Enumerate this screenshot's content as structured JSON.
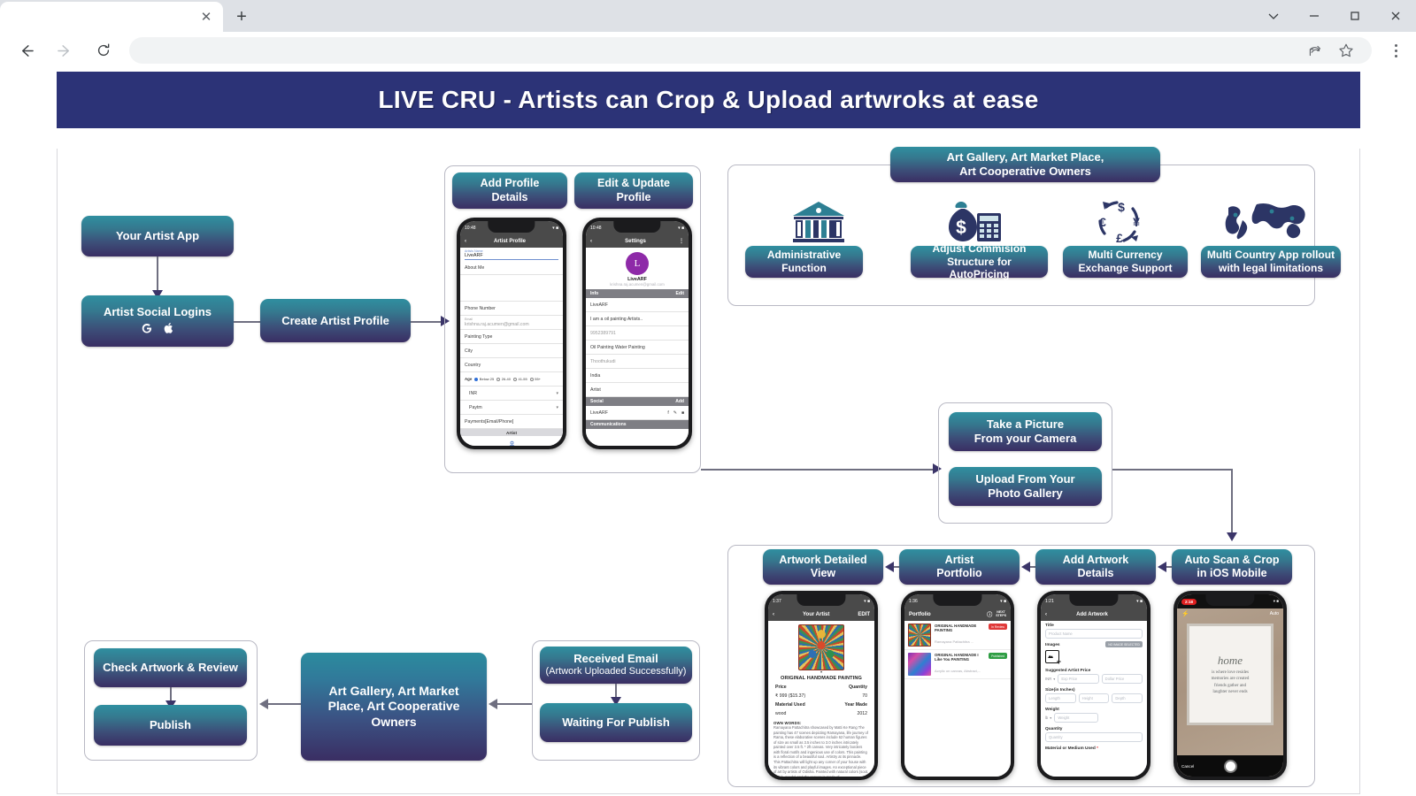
{
  "browser": {
    "tab_title": "",
    "tab_close_icon": "close-icon",
    "new_tab_icon": "plus-icon",
    "window_controls": [
      "chevron-down-icon",
      "minimize-icon",
      "maximize-icon",
      "close-icon"
    ],
    "back_icon": "back-arrow-icon",
    "forward_icon": "forward-arrow-icon",
    "reload_icon": "reload-icon",
    "address_value": "",
    "address_placeholder": "",
    "share_icon": "share-icon",
    "bookmark_icon": "star-icon",
    "menu_icon": "kebab-menu-icon"
  },
  "banner": {
    "title": "LIVE CRU - Artists can Crop & Upload artwroks at ease",
    "bg": "#2c3377"
  },
  "theme": {
    "gradient_top": "#2f8fa0",
    "gradient_bottom": "#3a2e63",
    "line": "#6f6f80",
    "border": "#b9b9c4"
  },
  "flow": {
    "your_artist_app": "Your Artist App",
    "artist_social_logins": "Artist Social Logins",
    "social_icons": [
      "google-icon",
      "apple-icon"
    ],
    "create_artist_profile": "Create Artist Profile",
    "add_profile_details": "Add Profile\nDetails",
    "add_profile_details_l1": "Add Profile",
    "add_profile_details_l2": "Details",
    "edit_update_profile_l1": "Edit & Update",
    "edit_update_profile_l2": "Profile",
    "take_picture_l1": "Take a Picture",
    "take_picture_l2": "From your Camera",
    "upload_gallery_l1": "Upload From Your",
    "upload_gallery_l2": "Photo Gallery",
    "auto_scan_l1": "Auto Scan & Crop",
    "auto_scan_l2": "in iOS Mobile",
    "add_artwork_details_l1": "Add Artwork",
    "add_artwork_details_l2": "Details",
    "artist_portfolio_l1": "Artist",
    "artist_portfolio_l2": "Portfolio",
    "artwork_detailed_view_l1": "Artwork Detailed",
    "artwork_detailed_view_l2": "View",
    "received_email_l1": "Received Email",
    "received_email_l2": "(Artwork Uploaded Successfully)",
    "waiting_for_publish": "Waiting For Publish",
    "gallery_owners_l1": "Art Gallery, Art Market",
    "gallery_owners_l2": "Place, Art Cooperative",
    "gallery_owners_l3": "Owners",
    "check_artwork_review": "Check Artwork & Review",
    "publish": "Publish"
  },
  "gallery_panel": {
    "header_l1": "Art Gallery, Art Market Place,",
    "header_l2": "Art Cooperative Owners",
    "features": [
      {
        "icon": "bank-building-icon",
        "label_l1": "Administrative",
        "label_l2": "Function"
      },
      {
        "icon": "money-bag-calculator-icon",
        "label_l1": "Adjust Commision",
        "label_l2": "Structure for AutoPricing"
      },
      {
        "icon": "currency-exchange-icon",
        "label_l1": "Multi Currency",
        "label_l2": "Exchange Support"
      },
      {
        "icon": "world-map-icon",
        "label_l1": "Multi Country App rollout",
        "label_l2": "with legal limitations"
      }
    ]
  },
  "phones": {
    "artist_profile": {
      "time": "10:48",
      "title": "Artist Profile",
      "back_icon": "chevron-left-icon",
      "field_label": "Artists Name",
      "field_value": "LiveARF",
      "rows": [
        "About Me",
        "",
        "Phone Number",
        "krishna.raj.acumen@gmail.com",
        "Painting Type",
        "City",
        "Country"
      ],
      "email_label": "Email",
      "age_label": "Age",
      "age_options": [
        "Below 25",
        "26-40",
        "41-55",
        "55+"
      ],
      "age_selected": "Below 25",
      "pay_rows": [
        "INR",
        "Paytm",
        "Payments[Email/Phone]"
      ],
      "tabbar": "Artist",
      "tabbar_icon": "person-icon"
    },
    "settings": {
      "time": "10:48",
      "title": "Settings",
      "back_icon": "chevron-left-icon",
      "more_icon": "more-vertical-icon",
      "avatar_letter": "L",
      "profile_name": "LiveARF",
      "profile_email": "krishna.raj.acumen@gmail.com",
      "info_header": "Info",
      "info_edit": "Edit",
      "info_rows": [
        "LiveARF",
        "I am a oil painting Artists..",
        "9952389791",
        "Oil Painting Water Painting",
        "Thoothukudi",
        "India",
        "Artist"
      ],
      "social_header": "Social",
      "social_add": "Add",
      "social_row": "LiveARF",
      "social_icons": [
        "facebook-icon",
        "edit-pencil-icon",
        "delete-icon"
      ],
      "footer_row": "Communications"
    },
    "artwork_detail": {
      "time": "1:37",
      "title": "Your Artist",
      "edit": "EDIT",
      "back_icon": "chevron-left-icon",
      "artwork_title": "ORIGINAL HANDMADE PAINTING",
      "price_label": "Price",
      "quantity_label": "Quantity",
      "price_value": "₹ 999 ($15.37)",
      "quantity_value": "70",
      "material_label": "Material Used",
      "year_label": "Year Made",
      "material_value": "wood",
      "year_value": "2012",
      "own_words_label": "OWN WORDS:",
      "own_words_text": "Ramayana Pattachitra showcased by Matti Ke Rang The painting has 47 scenes depicting Ramayana, life journey of Rama, these elaborative scenes include 62 human figures of size as small as 3.5 inches to 3.0 inches intricately painted over 3.5 ft. * 2ft canvas. Very intricately borders with floral motifs and ingenious use of colors. This painting is a reflection of a beautiful soul. Artistry at its pinnacle. This Pattachitra will light up any corner of your house with its vibrant colors and playful images. An exceptional piece of art by artists of Odisha. Painted with natural colors (soot, conch, seeds) and the canvas is made of"
    },
    "portfolio": {
      "time": "1:36",
      "title": "Portfolio",
      "info_icon": "info-icon",
      "next_steps": "NEXT\nSTEPS",
      "next_steps_l1": "NEXT",
      "next_steps_l2": "STEPS",
      "items": [
        {
          "name": "ORIGINAL HANDMADE PAINTING",
          "desc": "Ramayana Pattachitra ...",
          "badge": "In Review",
          "badge_color": "#e03a3a"
        },
        {
          "name": "ORIGINAL HANDMADE I Like You PAINTING",
          "desc": "Acrylic on canvas, Abstract,...",
          "badge": "Published",
          "badge_color": "#2f9e44"
        }
      ],
      "fab_icon": "plus-icon"
    },
    "add_artwork": {
      "time": "1:21",
      "title": "Add Artwork",
      "back_icon": "chevron-left-icon",
      "title_label": "Title",
      "title_placeholder": "Product Name",
      "images_label": "Images",
      "images_chip": "NO IMAGE SELECTED",
      "image_picker_icon": "add-image-icon",
      "price_label": "Suggested Artist Price",
      "price_currency": "INR",
      "price_placeholder_1": "Exp Price",
      "price_placeholder_2": "Dollar Price",
      "size_label": "Size(in Inches)",
      "size_placeholders": [
        "Length",
        "Height",
        "Depth"
      ],
      "weight_label": "Weight",
      "weight_unit": "lb",
      "weight_placeholder": "Weight",
      "quantity_label": "Quantity",
      "quantity_placeholder": "Quantity",
      "material_label": "Material or Medium Used"
    },
    "camera_scan": {
      "time": "2:18",
      "flash_icon": "flash-icon",
      "auto_label": "Auto",
      "cancel_label": "Cancel",
      "shutter_icon": "shutter-icon",
      "art_heading": "home",
      "art_body_l1": "is where love resides",
      "art_body_l2": "memories are created",
      "art_body_l3": "friends gather and",
      "art_body_l4": "laughter never ends"
    }
  }
}
